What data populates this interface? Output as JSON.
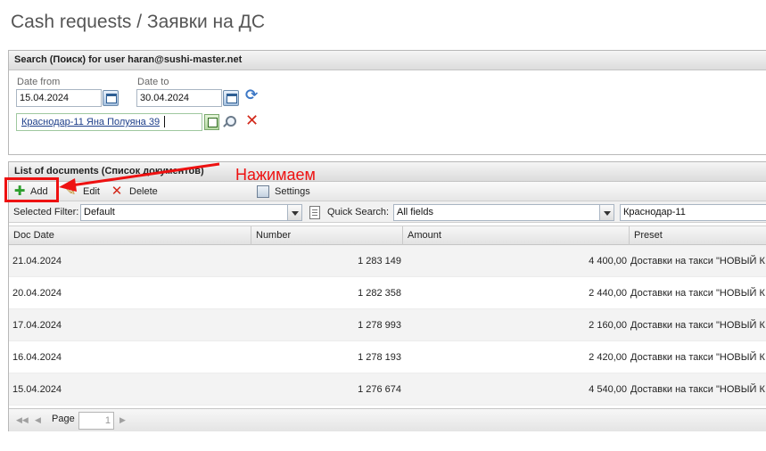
{
  "page_title": "Cash requests / Заявки на ДС",
  "search": {
    "header": "Search (Поиск) for user haran@sushi-master.net",
    "date_from_label": "Date from",
    "date_from_value": "15.04.2024",
    "date_to_label": "Date to",
    "date_to_value": "30.04.2024",
    "preset_value": "Краснодар-11 Яна Полуяна 39"
  },
  "list": {
    "header": "List of documents (Список документов)",
    "toolbar": {
      "add_label": "Add",
      "edit_label": "Edit",
      "delete_label": "Delete",
      "settings_label": "Settings"
    },
    "filter": {
      "selected_filter_label": "Selected Filter:",
      "selected_filter_value": "Default",
      "quick_search_label": "Quick Search:",
      "quick_search_field": "All fields",
      "quick_search_text": "Краснодар-11"
    },
    "columns": [
      "Doc Date",
      "Number",
      "Amount",
      "Preset"
    ],
    "rows": [
      {
        "date": "21.04.2024",
        "number": "1 283 149",
        "amount": "4 400,00",
        "preset": "Доставки на такси \"НОВЫЙ К"
      },
      {
        "date": "20.04.2024",
        "number": "1 282 358",
        "amount": "2 440,00",
        "preset": "Доставки на такси \"НОВЫЙ К"
      },
      {
        "date": "17.04.2024",
        "number": "1 278 993",
        "amount": "2 160,00",
        "preset": "Доставки на такси \"НОВЫЙ К"
      },
      {
        "date": "16.04.2024",
        "number": "1 278 193",
        "amount": "2 420,00",
        "preset": "Доставки на такси \"НОВЫЙ К"
      },
      {
        "date": "15.04.2024",
        "number": "1 276 674",
        "amount": "4 540,00",
        "preset": "Доставки на такси \"НОВЫЙ К"
      }
    ],
    "pager": {
      "page_label": "Page",
      "page_value": "1"
    }
  },
  "annotation": {
    "text": "Нажимаем",
    "color": "#ee1111"
  },
  "colors": {
    "delete_red": "#d2281a",
    "add_green": "#2e9e2e",
    "refresh_blue": "#3d78c6"
  }
}
